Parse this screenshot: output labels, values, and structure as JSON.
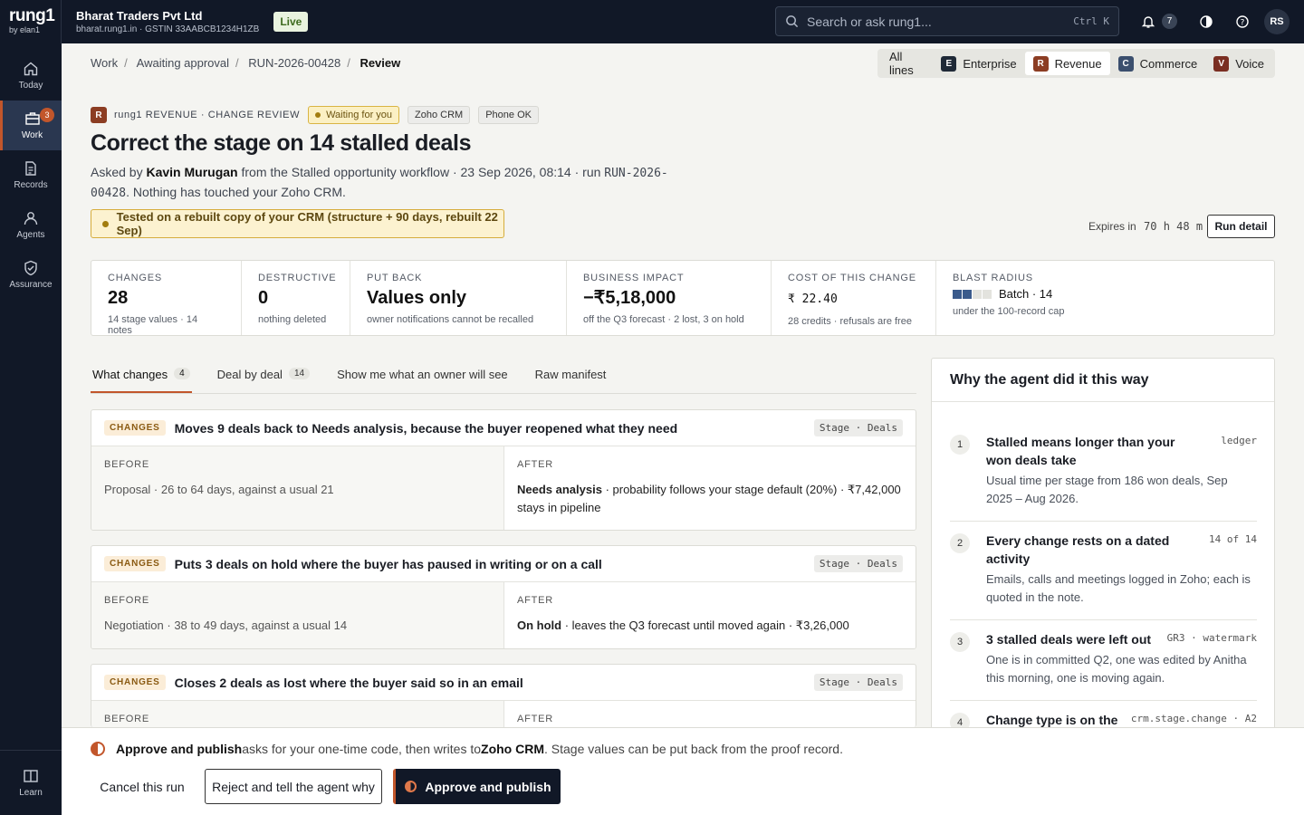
{
  "brand": {
    "name": "rung1",
    "by": "by elan1"
  },
  "org": {
    "name": "Bharat Traders Pvt Ltd",
    "sub": "bharat.rung1.in · GSTIN 33AABCB1234H1ZB",
    "status": "Live"
  },
  "search": {
    "placeholder": "Search or ask rung1...",
    "shortcut": "Ctrl K"
  },
  "notifications": {
    "count": "7"
  },
  "user": {
    "initials": "RS"
  },
  "sidebar": {
    "items": [
      {
        "label": "Today",
        "icon": "home-icon"
      },
      {
        "label": "Work",
        "icon": "briefcase-icon",
        "badge": "3"
      },
      {
        "label": "Records",
        "icon": "document-icon"
      },
      {
        "label": "Agents",
        "icon": "person-icon"
      },
      {
        "label": "Assurance",
        "icon": "shield-check-icon"
      }
    ],
    "bottom": {
      "label": "Learn",
      "icon": "book-icon"
    }
  },
  "breadcrumb": [
    "Work",
    "Awaiting approval",
    "RUN-2026-00428",
    "Review"
  ],
  "filters": [
    {
      "label": "All lines"
    },
    {
      "label": "Enterprise",
      "letter": "E",
      "color": "#1f2937"
    },
    {
      "label": "Revenue",
      "letter": "R",
      "color": "#8c3d23"
    },
    {
      "label": "Commerce",
      "letter": "C",
      "color": "#3b4f6e"
    },
    {
      "label": "Voice",
      "letter": "V",
      "color": "#7a2e22"
    }
  ],
  "review": {
    "letter": "R",
    "kicker": "rung1 REVENUE · CHANGE REVIEW",
    "pills": [
      "Waiting for you",
      "Zoho CRM",
      "Phone OK"
    ],
    "title": "Correct the stage on 14 stalled deals",
    "meta_pre": "Asked by ",
    "asker": "Kavin Murugan",
    "meta_post": " from the Stalled opportunity workflow · 23 Sep 2026, 08:14 · run ",
    "run_id": "RUN-2026-00428",
    "meta_end": ". Nothing has touched your Zoho CRM.",
    "tested": "Tested on a rebuilt copy of your CRM (structure + 90 days, rebuilt 22 Sep)",
    "expires_label": "Expires in",
    "expires_value": "70 h 48 m",
    "run_detail": "Run detail"
  },
  "stats": [
    {
      "key": "CHANGES",
      "value": "28",
      "sub": "14 stage values · 14 notes"
    },
    {
      "key": "DESTRUCTIVE",
      "value": "0",
      "sub": "nothing deleted"
    },
    {
      "key": "PUT BACK",
      "value": "Values only",
      "sub": "owner notifications cannot be recalled"
    },
    {
      "key": "BUSINESS IMPACT",
      "value": "−₹5,18,000",
      "sub": "off the Q3 forecast · 2 lost, 3 on hold"
    },
    {
      "key": "COST OF THIS CHANGE",
      "value": "₹ 22.40",
      "sub": "28 credits · refusals are free"
    },
    {
      "key": "BLAST RADIUS",
      "value": "Batch · 14",
      "sub": "under the 100-record cap",
      "blast_fill": 0.14
    }
  ],
  "tabs": [
    {
      "label": "What changes",
      "count": "4"
    },
    {
      "label": "Deal by deal",
      "count": "14"
    },
    {
      "label": "Show me what an owner will see"
    },
    {
      "label": "Raw manifest"
    }
  ],
  "changes": [
    {
      "tag": "CHANGES",
      "title": "Moves 9 deals back to Needs analysis, because the buyer reopened what they need",
      "stage": "Stage · Deals",
      "before_label": "BEFORE",
      "before": "Proposal · 26 to 64 days, against a usual 21",
      "after_label": "AFTER",
      "after_bold": "Needs analysis",
      "after": " · probability follows your stage default (20%) · ₹7,42,000 stays in pipeline"
    },
    {
      "tag": "CHANGES",
      "title": "Puts 3 deals on hold where the buyer has paused in writing or on a call",
      "stage": "Stage · Deals",
      "before_label": "BEFORE",
      "before": "Negotiation · 38 to 49 days, against a usual 14",
      "after_label": "AFTER",
      "after_bold": "On hold",
      "after": " · leaves the Q3 forecast until moved again · ₹3,26,000"
    },
    {
      "tag": "CHANGES",
      "title": "Closes 2 deals as lost where the buyer said so in an email",
      "stage": "Stage · Deals",
      "before_label": "BEFORE",
      "before": "",
      "after_label": "AFTER",
      "after_bold": "",
      "after": ""
    }
  ],
  "why": {
    "title": "Why the agent did it this way",
    "items": [
      {
        "n": "1",
        "title": "Stalled means longer than your won deals take",
        "desc": "Usual time per stage from 186 won deals, Sep 2025 – Aug 2026.",
        "tag": "ledger"
      },
      {
        "n": "2",
        "title": "Every change rests on a dated activity",
        "desc": "Emails, calls and meetings logged in Zoho; each is quoted in the note.",
        "tag": "14 of 14"
      },
      {
        "n": "3",
        "title": "3 stalled deals were left out",
        "desc": "One is in committed Q2, one was edited by Anitha this morning, one is moving again.",
        "tag": "GR3 · watermark"
      },
      {
        "n": "4",
        "title": "Change type is on the",
        "desc": "",
        "tag": "crm.stage.change · A2"
      }
    ]
  },
  "footer": {
    "msg_bold1": "Approve and publish",
    "msg1": " asks for your one-time code, then writes to ",
    "msg_bold2": "Zoho CRM",
    "msg2": ". Stage values can be put back from the proof record.",
    "cancel": "Cancel this run",
    "reject": "Reject and tell the agent why",
    "approve": "Approve and publish"
  }
}
